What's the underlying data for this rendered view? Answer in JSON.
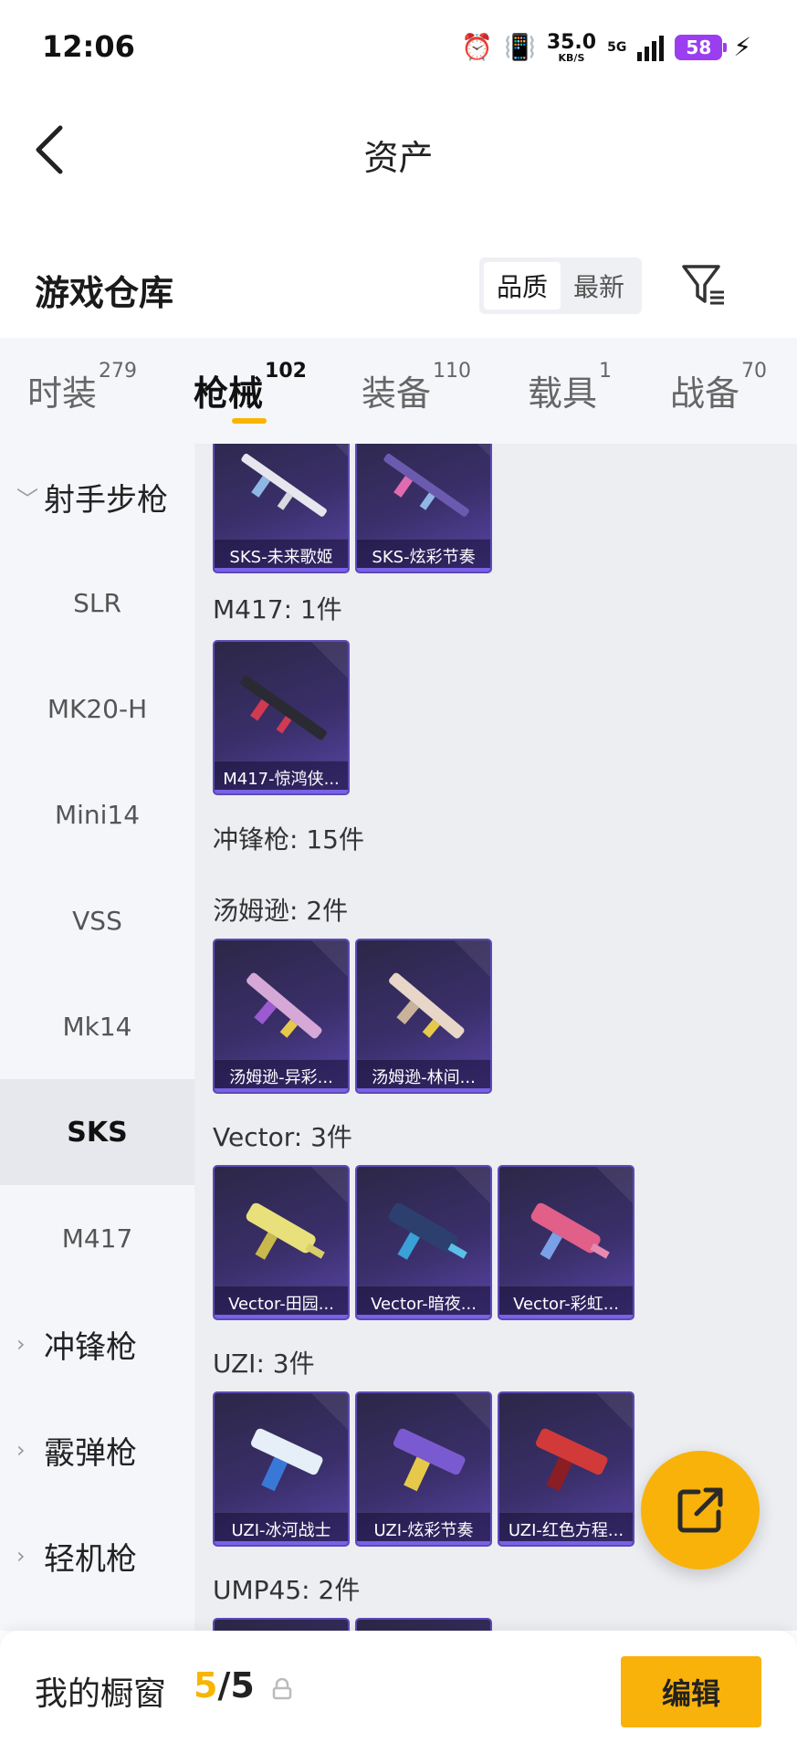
{
  "status_bar": {
    "time": "12:06",
    "speed_value": "35.0",
    "speed_unit": "KB/S",
    "network": "5G",
    "battery": "58"
  },
  "header": {
    "back_icon": "chevron-left-icon",
    "title": "资产"
  },
  "warehouse": {
    "title": "游戏仓库",
    "sort_options": [
      "品质",
      "最新"
    ],
    "sort_selected": "品质",
    "filter_icon": "filter-icon"
  },
  "tabs": [
    {
      "label": "时装",
      "count": "279"
    },
    {
      "label": "枪械",
      "count": "102"
    },
    {
      "label": "装备",
      "count": "110"
    },
    {
      "label": "载具",
      "count": "1"
    },
    {
      "label": "战备",
      "count": "70"
    }
  ],
  "active_tab": "枪械",
  "sidebar": {
    "items": [
      {
        "label": "射手步枪",
        "type": "group",
        "expanded": true
      },
      {
        "label": "SLR"
      },
      {
        "label": "MK20-H"
      },
      {
        "label": "Mini14"
      },
      {
        "label": "VSS"
      },
      {
        "label": "Mk14"
      },
      {
        "label": "SKS",
        "active": true
      },
      {
        "label": "M417"
      },
      {
        "label": "冲锋枪",
        "type": "group"
      },
      {
        "label": "霰弹枪",
        "type": "group"
      },
      {
        "label": "轻机枪",
        "type": "group"
      }
    ]
  },
  "content": {
    "sks_cards": [
      "SKS-未来歌姬",
      "SKS-炫彩节奏"
    ],
    "m417_label": "M417: 1件",
    "m417_cards": [
      "M417-惊鸿侠..."
    ],
    "smg_label": "冲锋枪: 15件",
    "thompson_label": "汤姆逊: 2件",
    "thompson_cards": [
      "汤姆逊-异彩...",
      "汤姆逊-林间..."
    ],
    "vector_label": "Vector: 3件",
    "vector_cards": [
      "Vector-田园...",
      "Vector-暗夜...",
      "Vector-彩虹..."
    ],
    "uzi_label": "UZI: 3件",
    "uzi_cards": [
      "UZI-冰河战士",
      "UZI-炫彩节奏",
      "UZI-红色方程..."
    ],
    "ump_label": "UMP45: 2件"
  },
  "colors": {
    "accent": "#f9b20a",
    "card_bg": "#3a2f6a",
    "card_border": "#5d4ab8"
  },
  "fab": {
    "icon": "share-external-icon"
  },
  "bottom_bar": {
    "label": "我的橱窗",
    "count_current": "5",
    "count_sep": "/",
    "count_total": "5",
    "lock_icon": "lock-icon",
    "edit_label": "编辑"
  }
}
